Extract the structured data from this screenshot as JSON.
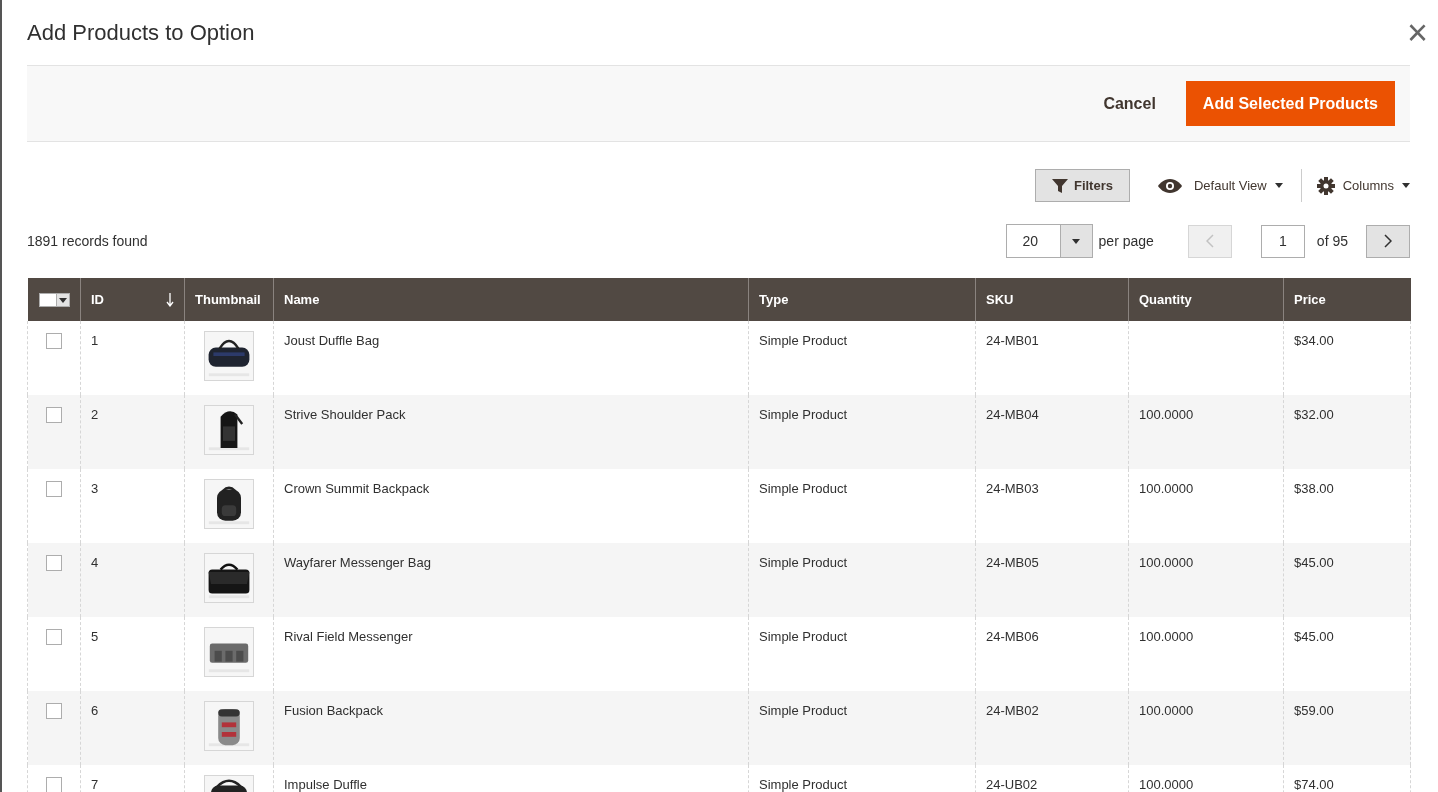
{
  "modal": {
    "title": "Add Products to Option",
    "close_label": "×"
  },
  "actions": {
    "cancel": "Cancel",
    "primary": "Add Selected Products"
  },
  "toolbar": {
    "filters": "Filters",
    "view": "Default View",
    "columns": "Columns"
  },
  "records": "1891 records found",
  "pagination": {
    "per_page_value": "20",
    "per_page_label": "per page",
    "page": "1",
    "of": "of 95",
    "prev_disabled": true
  },
  "table": {
    "columns": [
      {
        "label": "ID",
        "sorted": true
      },
      {
        "label": "Thumbnail",
        "sorted": false
      },
      {
        "label": "Name",
        "sorted": false
      },
      {
        "label": "Type",
        "sorted": false
      },
      {
        "label": "SKU",
        "sorted": false
      },
      {
        "label": "Quantity",
        "sorted": false
      },
      {
        "label": "Price",
        "sorted": false
      }
    ],
    "rows": [
      {
        "checked": false,
        "id": "1",
        "name": "Joust Duffle Bag",
        "type": "Simple Product",
        "sku": "24-MB01",
        "quantity": "",
        "price": "$34.00"
      },
      {
        "checked": false,
        "id": "2",
        "name": "Strive Shoulder Pack",
        "type": "Simple Product",
        "sku": "24-MB04",
        "quantity": "100.0000",
        "price": "$32.00"
      },
      {
        "checked": false,
        "id": "3",
        "name": "Crown Summit Backpack",
        "type": "Simple Product",
        "sku": "24-MB03",
        "quantity": "100.0000",
        "price": "$38.00"
      },
      {
        "checked": false,
        "id": "4",
        "name": "Wayfarer Messenger Bag",
        "type": "Simple Product",
        "sku": "24-MB05",
        "quantity": "100.0000",
        "price": "$45.00"
      },
      {
        "checked": false,
        "id": "5",
        "name": "Rival Field Messenger",
        "type": "Simple Product",
        "sku": "24-MB06",
        "quantity": "100.0000",
        "price": "$45.00"
      },
      {
        "checked": false,
        "id": "6",
        "name": "Fusion Backpack",
        "type": "Simple Product",
        "sku": "24-MB02",
        "quantity": "100.0000",
        "price": "$59.00"
      },
      {
        "checked": false,
        "id": "7",
        "name": "Impulse Duffle",
        "type": "Simple Product",
        "sku": "24-UB02",
        "quantity": "100.0000",
        "price": "$74.00"
      }
    ]
  }
}
